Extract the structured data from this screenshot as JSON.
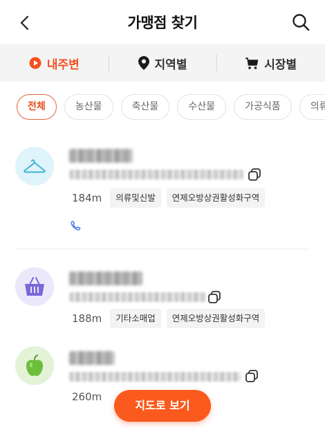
{
  "header": {
    "title": "가맹점 찾기",
    "back_icon": "chevron-left-icon",
    "search_icon": "search-icon"
  },
  "tabs": [
    {
      "label": "내주변",
      "icon": "location-arrow-icon",
      "active": true
    },
    {
      "label": "지역별",
      "icon": "map-pin-icon",
      "active": false
    },
    {
      "label": "시장별",
      "icon": "shopping-cart-icon",
      "active": false
    }
  ],
  "categories": [
    {
      "label": "전체",
      "active": true
    },
    {
      "label": "농산물",
      "active": false
    },
    {
      "label": "축산물",
      "active": false
    },
    {
      "label": "수산물",
      "active": false
    },
    {
      "label": "가공식품",
      "active": false
    },
    {
      "label": "의류및신",
      "active": false
    }
  ],
  "stores": [
    {
      "icon": "hanger-icon",
      "distance": "184m",
      "category": "의류및신발",
      "area": "연제오방상권활성화구역"
    },
    {
      "icon": "basket-icon",
      "distance": "188m",
      "category": "기타소매업",
      "area": "연제오방상권활성화구역"
    },
    {
      "icon": "apple-icon",
      "distance": "260m",
      "category": "",
      "area": ""
    }
  ],
  "map_button": {
    "label": "지도로 보기"
  },
  "colors": {
    "accent": "#f4511e",
    "button": "#fa5a1e",
    "hanger_bg": "#dff3fb",
    "basket_bg": "#ece8fb",
    "apple_bg": "#e4f2d8"
  }
}
